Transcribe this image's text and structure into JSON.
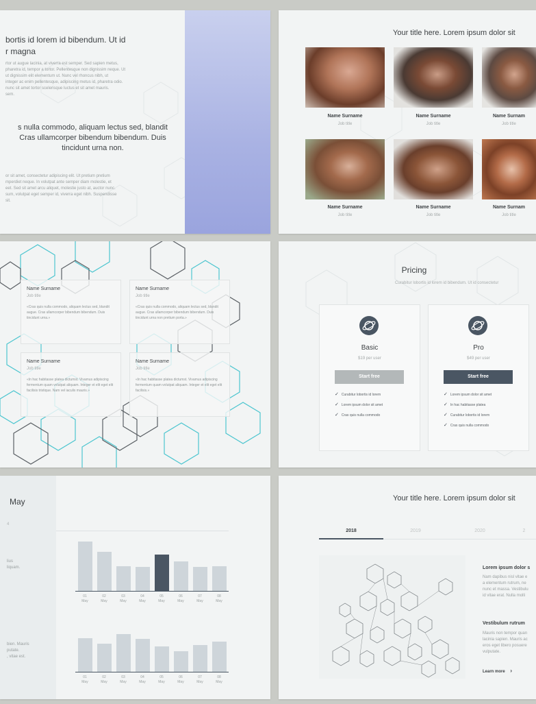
{
  "slide1": {
    "heading": "bortis id lorem id bibendum. Ut id",
    "heading2": "r magna",
    "para1": [
      "rtor ut augue lacinia, at viverra est semper. Sed sapien metus,",
      "pharetra id, tempor a tortor. Pellentesque non dignissim neque. Ut",
      "ut dignissim elit elementum ut. Nunc vel rhoncus nibh, ut",
      "integer ac enim pellentesque, adipiscing metus id, pharetra odio.",
      "nunc sit amet tortor scelerisque luctus et sit amet mauris.",
      "sem."
    ],
    "quote": [
      "s nulla commodo, aliquam lectus sed, blandit",
      "Cras ullamcorper bibendum bibendum. Duis",
      "tincidunt urna non."
    ],
    "para2": [
      "or sit amet, consectetur adipiscing elit. Ut pretium pretium",
      "mperdiet neque. In volutpat ante semper diam molestie, et",
      "eet. Sed sit amet arcu aliquet, molestie justo at, auctor nunc.",
      "sum, volutpat eget semper id, viverra eget nibh. Suspendisse",
      "sit."
    ]
  },
  "slide2": {
    "title": "Your title here. Lorem ipsum dolor sit",
    "people": [
      {
        "name": "Name Surname",
        "job": "Job title"
      },
      {
        "name": "Name Surname",
        "job": "Job title"
      },
      {
        "name": "Name Surnam",
        "job": "Job title"
      },
      {
        "name": "Name Surname",
        "job": "Job title"
      },
      {
        "name": "Name Surname",
        "job": "Job title"
      },
      {
        "name": "Name Surnam",
        "job": "Job title"
      }
    ]
  },
  "slide3": {
    "cards": [
      {
        "name": "Name Surname",
        "job": "Job title",
        "quote": "«Cras quis nulla commodo, aliquam lectus sed, blandit augue. Cras ullamcorper bibendum bibendum. Duis tincidunt urna.»"
      },
      {
        "name": "Name Surname",
        "job": "Job title",
        "quote": "«Cras quis nulla commodo, aliquam lectus sed, blandit augue. Cras ullamcorper bibendum bibendum. Duis tincidunt urna non pretium porta.»"
      },
      {
        "name": "Name Surname",
        "job": "Job title",
        "quote": "«In hac habitasse platea dictumst. Vivamus adipiscing fermentum quam volutpat aliquam. Integer et elit eget elit facilisis tristique. Nam vel iaculis mauris.»"
      },
      {
        "name": "Name Surname",
        "job": "Job title",
        "quote": "«In hac habitasse platea dictumst. Vivamus adipiscing fermentum quam volutpat aliquam. Integer et elit eget elit facilisis.»"
      }
    ]
  },
  "slide4": {
    "title": "Pricing",
    "subtitle": "Curabitur lobortis id lorem id bibendum. Ut id consectetur",
    "plans": [
      {
        "name": "Basic",
        "price": "$19 per user",
        "button": "Start free",
        "button_color": "#b3b8b9",
        "features": [
          "Curabitur lobortis id lorem",
          "Lorem ipsum dolor sit amet",
          "Cras quis nulla commodo"
        ]
      },
      {
        "name": "Pro",
        "price": "$49 per user",
        "button": "Start free",
        "button_color": "#4a5663",
        "features": [
          "Lorem ipsum dolor sit amet",
          "In hac habitasse platea",
          "Curabitur lobortis id lorem",
          "Cras quis nulla commodo"
        ]
      }
    ]
  },
  "slide5": {
    "title": "May",
    "sub": "4",
    "side_text1": [
      "lius",
      "liquam."
    ],
    "side_text2": [
      "bien. Mauris",
      "putate.",
      ", vitae est."
    ]
  },
  "slide6": {
    "title": "Your title here. Lorem ipsum dolor sit",
    "tabs": [
      "2018",
      "2019",
      "2020",
      "2"
    ],
    "block1_title": "Lorem ipsum dolor s",
    "block1_text": [
      "Nam dapibus nisl vitae e",
      "a elementum rutrum, ne",
      "nunc et massa. Vestibulu",
      "id vitae erat. Nulla molli"
    ],
    "block2_title": "Vestibulum rutrum",
    "block2_text": [
      "Mauris non tempor quan",
      "lacinia sapien. Mauris ac",
      "eros eget libero posuere",
      "vulputate."
    ],
    "learn_more": "Learn more"
  },
  "chart_data": [
    {
      "type": "bar",
      "categories": [
        "01 May",
        "02 May",
        "03 May",
        "04 May",
        "05 May",
        "06 May",
        "07 May",
        "08 May"
      ],
      "values": [
        72,
        57,
        36,
        35,
        53,
        43,
        35,
        36
      ],
      "highlight_index": 4,
      "colors": {
        "bar": "#ced5da",
        "highlight": "#4a5663"
      }
    },
    {
      "type": "bar",
      "categories": [
        "01 May",
        "02 May",
        "03 May",
        "04 May",
        "05 May",
        "06 May",
        "07 May",
        "08 May"
      ],
      "values": [
        49,
        41,
        55,
        48,
        37,
        30,
        39,
        44
      ],
      "colors": {
        "bar": "#ced5da"
      }
    }
  ]
}
